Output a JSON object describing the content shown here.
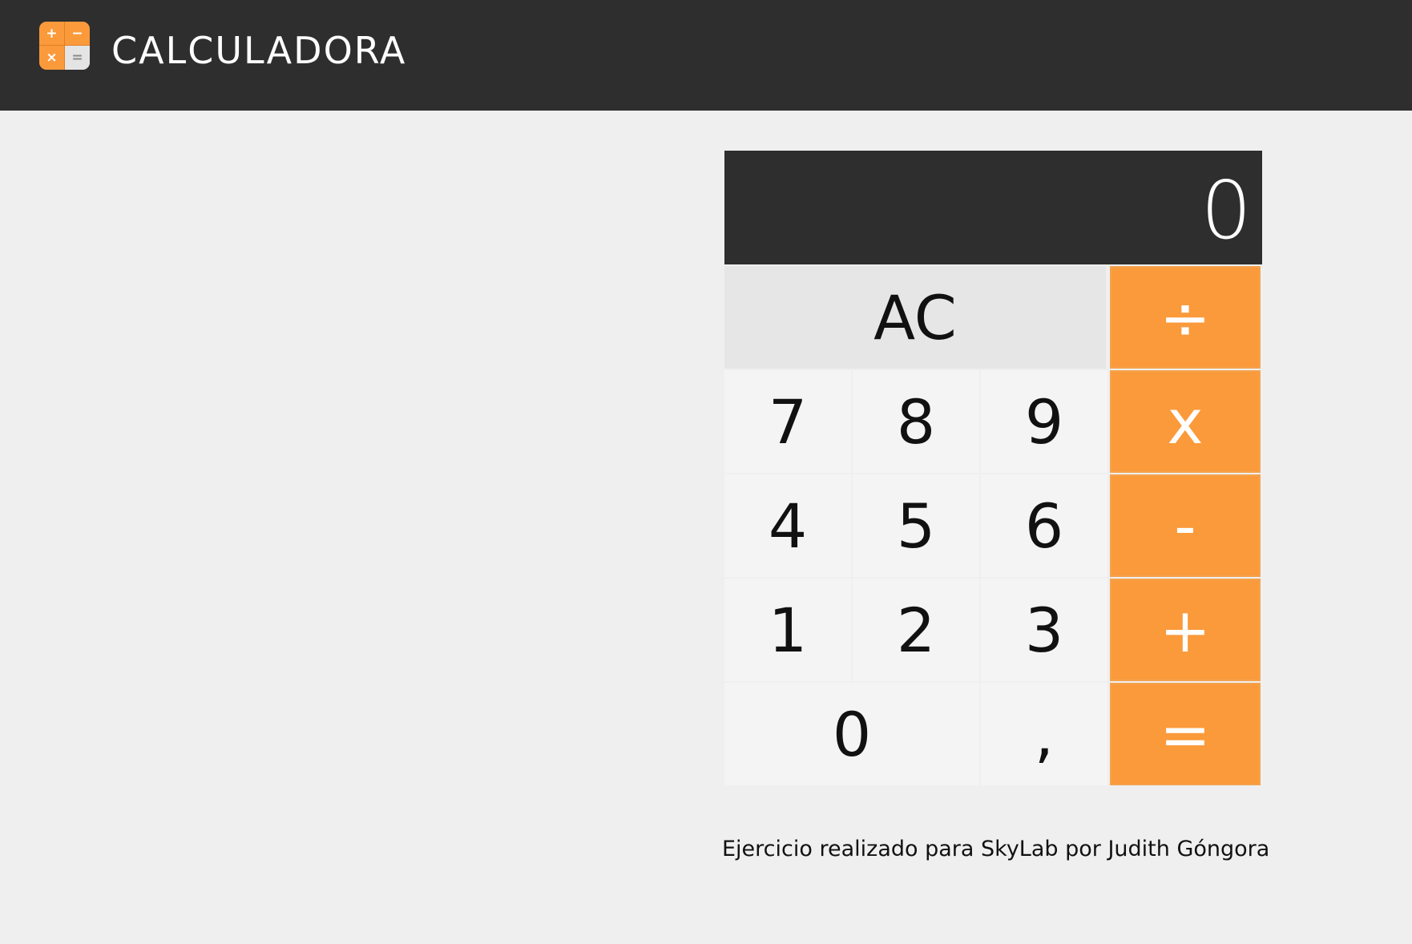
{
  "header": {
    "title": "CALCULADORA",
    "logo": {
      "icon": "calculator-app-icon",
      "plus": "+",
      "minus": "−",
      "times": "×",
      "equals": "="
    }
  },
  "calculator": {
    "display": "0",
    "keys": {
      "clear": "AC",
      "divide": "÷",
      "multiply": "x",
      "subtract": "-",
      "add": "+",
      "equals": "=",
      "seven": "7",
      "eight": "8",
      "nine": "9",
      "four": "4",
      "five": "5",
      "six": "6",
      "one": "1",
      "two": "2",
      "three": "3",
      "zero": "0",
      "decimal": ","
    }
  },
  "footer": {
    "credit": "Ejercicio realizado para SkyLab por Judith Góngora"
  },
  "colors": {
    "header_bg": "#2e2e2e",
    "page_bg": "#efefef",
    "accent_orange": "#fb9a3b",
    "number_key_bg": "#f4f4f4",
    "clear_key_bg": "#e6e6e6"
  }
}
